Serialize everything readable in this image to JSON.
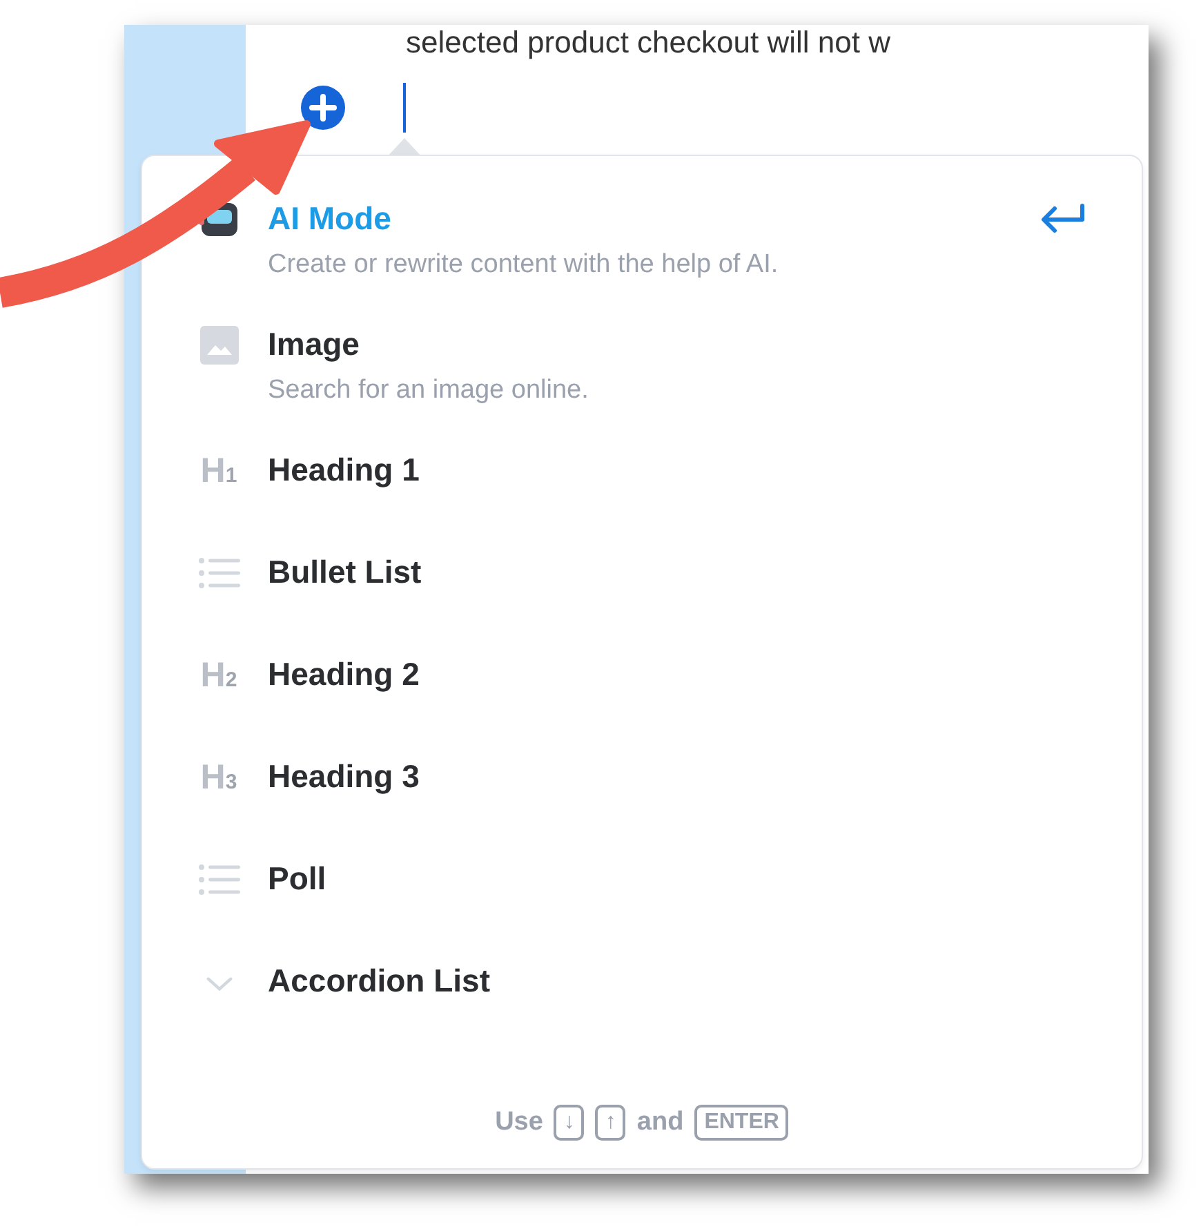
{
  "editor": {
    "text_above": "selected product checkout will not w"
  },
  "menu": {
    "items": [
      {
        "kind": "ai",
        "title": "AI Mode",
        "description": "Create or rewrite content with the help of AI.",
        "selected": true
      },
      {
        "kind": "image",
        "title": "Image",
        "description": "Search for an image online.",
        "selected": false
      },
      {
        "kind": "heading",
        "icon_text": "H",
        "icon_sub": "1",
        "title": "Heading 1",
        "selected": false
      },
      {
        "kind": "bullets",
        "title": "Bullet List",
        "selected": false
      },
      {
        "kind": "heading",
        "icon_text": "H",
        "icon_sub": "2",
        "title": "Heading 2",
        "selected": false
      },
      {
        "kind": "heading",
        "icon_text": "H",
        "icon_sub": "3",
        "title": "Heading 3",
        "selected": false
      },
      {
        "kind": "bullets",
        "title": "Poll",
        "selected": false
      },
      {
        "kind": "chevron",
        "title": "Accordion List",
        "selected": false
      }
    ],
    "footer": [
      {
        "kind": "word",
        "text": "Use"
      },
      {
        "kind": "key",
        "text": "↓"
      },
      {
        "kind": "key",
        "text": "↑"
      },
      {
        "kind": "word",
        "text": "and"
      },
      {
        "kind": "key",
        "text": "ENTER"
      }
    ]
  }
}
